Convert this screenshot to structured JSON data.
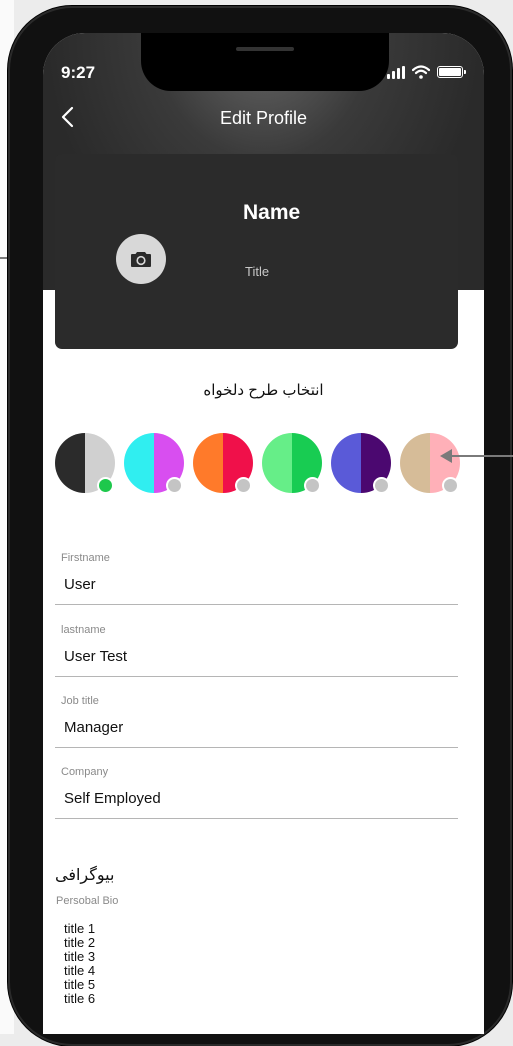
{
  "status_bar": {
    "time": "9:27"
  },
  "header": {
    "title": "Edit Profile"
  },
  "profile_card": {
    "name": "Name",
    "title": "Title"
  },
  "theme_section": {
    "heading": "انتخاب طرح دلخواه",
    "themes": [
      {
        "left_color": "#2b2b2b",
        "right_color": "#d0d0d0",
        "selected": true
      },
      {
        "left_color": "#30eef0",
        "right_color": "#d84ef0",
        "selected": false
      },
      {
        "left_color": "#ff7a2a",
        "right_color": "#f0104a",
        "selected": false
      },
      {
        "left_color": "#66ee88",
        "right_color": "#18cc52",
        "selected": false
      },
      {
        "left_color": "#5a5ad8",
        "right_color": "#4b0870",
        "selected": false
      },
      {
        "left_color": "#d6bc98",
        "right_color": "#ffb0b8",
        "selected": false
      }
    ],
    "selected_dot_color": "#1ec84c",
    "unselected_dot_color": "#c4c4c4"
  },
  "form": {
    "fields": [
      {
        "label": "Firstname",
        "value": "User"
      },
      {
        "label": "lastname",
        "value": "User Test"
      },
      {
        "label": "Job title",
        "value": "Manager"
      },
      {
        "label": "Company",
        "value": "Self Employed"
      }
    ]
  },
  "bio": {
    "heading": "بیوگرافی",
    "label": "Persobal Bio",
    "text": "title 1\ntitle 2\ntitle 3\ntitle 4\ntitle 5\ntitle 6"
  },
  "icons": {
    "back": "chevron-left-icon",
    "camera": "camera-icon",
    "signal": "cellular-signal-icon",
    "wifi": "wifi-icon",
    "battery": "battery-icon"
  }
}
